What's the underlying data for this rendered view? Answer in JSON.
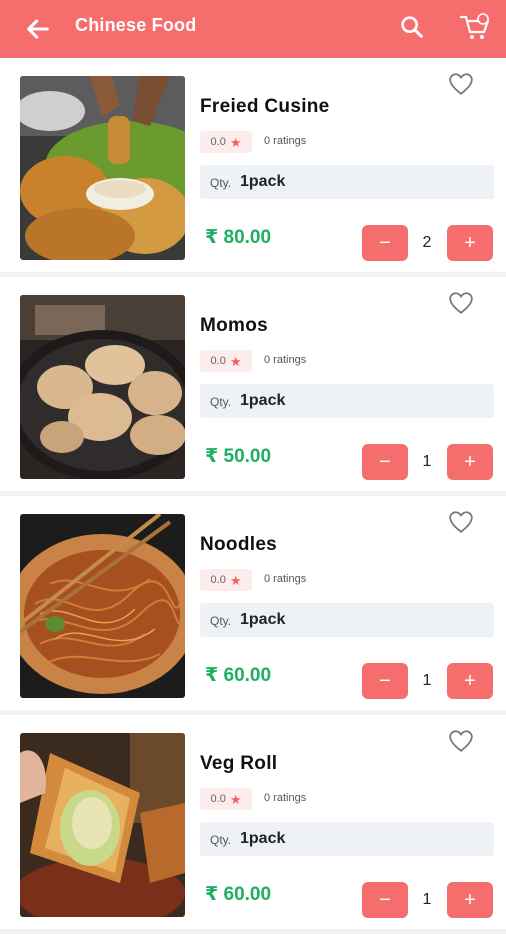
{
  "appbar": {
    "title": "Chinese Food",
    "icons": [
      "back-arrow-icon",
      "search-icon",
      "cart-icon"
    ],
    "color": "#f56d6d"
  },
  "products": [
    {
      "name": "Freied Cusine",
      "rating": "0.0",
      "ratings_text": "0 ratings",
      "qty_label": "Qty.",
      "qty_value": "1pack",
      "price": "₹ 80.00",
      "quantity": "2"
    },
    {
      "name": "Momos",
      "rating": "0.0",
      "ratings_text": "0 ratings",
      "qty_label": "Qty.",
      "qty_value": "1pack",
      "price": "₹ 50.00",
      "quantity": "1"
    },
    {
      "name": "Noodles",
      "rating": "0.0",
      "ratings_text": "0 ratings",
      "qty_label": "Qty.",
      "qty_value": "1pack",
      "price": "₹ 60.00",
      "quantity": "1"
    },
    {
      "name": "Veg Roll",
      "rating": "0.0",
      "ratings_text": "0 ratings",
      "qty_label": "Qty.",
      "qty_value": "1pack",
      "price": "₹ 60.00",
      "quantity": "1"
    }
  ],
  "controls": {
    "minus": "−",
    "plus": "+"
  },
  "colors": {
    "accent": "#f56d6d",
    "price": "#1fae62",
    "star": "#f45f5f",
    "rating_bg": "#fdecec",
    "qty_bg": "#eef2f6"
  }
}
